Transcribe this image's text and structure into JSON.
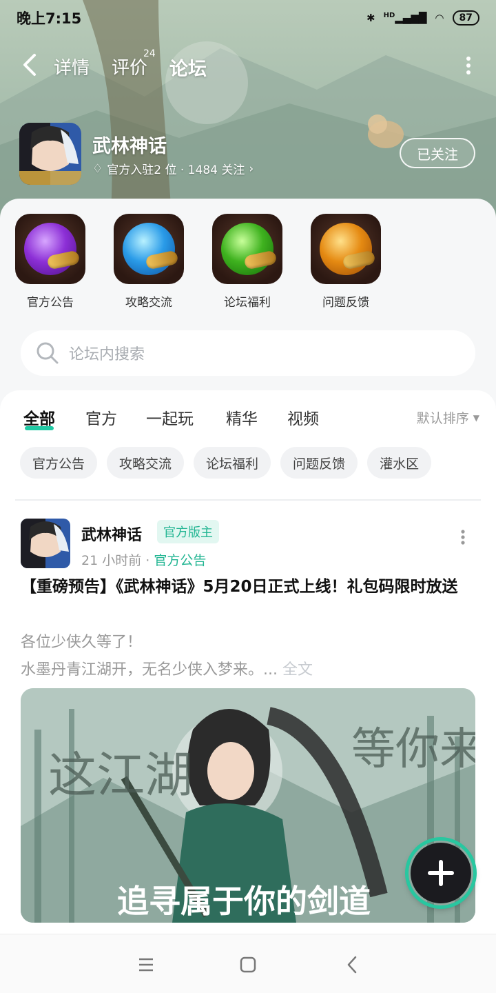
{
  "status_bar": {
    "time": "晚上7:15",
    "network": "HD",
    "battery": "87"
  },
  "nav": {
    "tabs": [
      "详情",
      "评价",
      "论坛"
    ],
    "review_count": "24",
    "active_tab": "论坛"
  },
  "game": {
    "name": "武林神话",
    "subtitle": "官方入驻2 位 · 1484 关注",
    "follow_label": "已关注"
  },
  "quick_entries": [
    {
      "label": "官方公告",
      "color": "#8c2fd6"
    },
    {
      "label": "攻略交流",
      "color": "#2a9be8"
    },
    {
      "label": "论坛福利",
      "color": "#3fb21f"
    },
    {
      "label": "问题反馈",
      "color": "#e58a12"
    }
  ],
  "search": {
    "placeholder": "论坛内搜索"
  },
  "feed_tabs": [
    "全部",
    "官方",
    "一起玩",
    "精华",
    "视频"
  ],
  "sort_label": "默认排序",
  "chips": [
    "官方公告",
    "攻略交流",
    "论坛福利",
    "问题反馈",
    "灌水区"
  ],
  "post": {
    "author": "武林神话",
    "badge": "官方版主",
    "time": "21 小时前",
    "category": "官方公告",
    "title": "【重磅预告】《武林神话》5月20日正式上线！礼包码限时放送",
    "line1": "各位少侠久等了！",
    "line2": "水墨丹青江湖开，无名少侠入梦来。...",
    "full_text": "全文",
    "image_caption": "追寻属于你的剑道",
    "image_left_text": "这江湖",
    "image_right_text": "等你来"
  },
  "colors": {
    "accent": "#21c9a4",
    "badge_text": "#21b592"
  }
}
